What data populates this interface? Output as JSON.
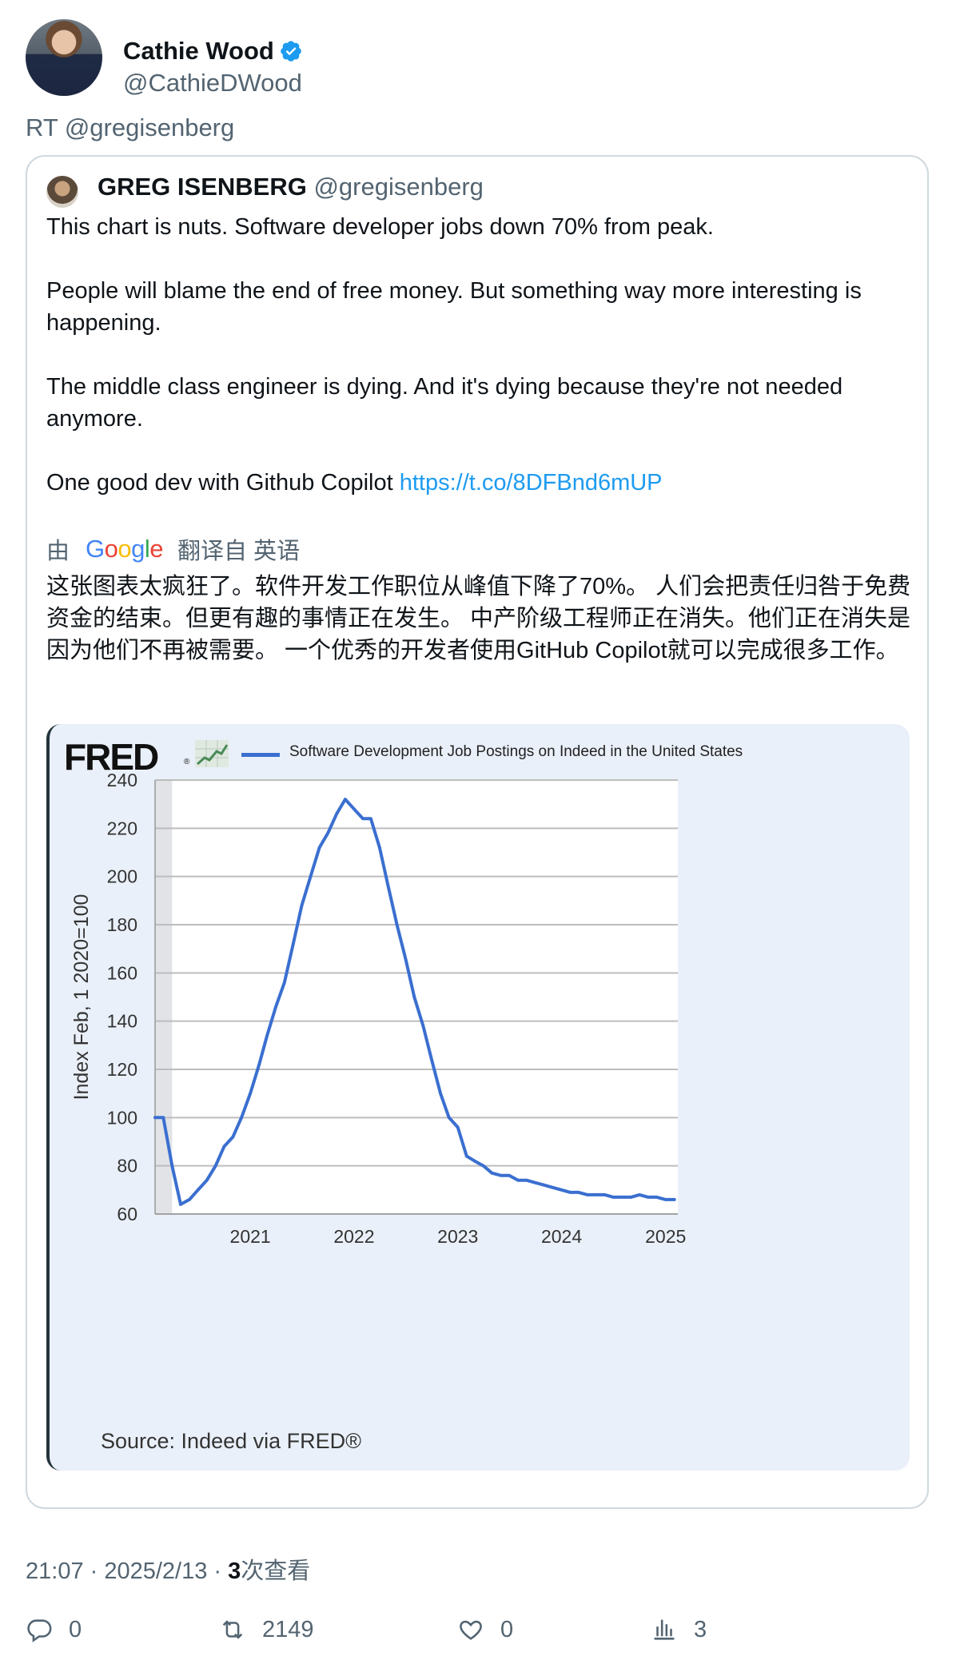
{
  "author": {
    "display_name": "Cathie Wood",
    "handle": "@CathieDWood",
    "verified": true,
    "avatar_icon": "profile-photo"
  },
  "retweet_line": "RT @gregisenberg",
  "quoted": {
    "display_name": "GREG ISENBERG",
    "handle": "@gregisenberg",
    "paragraphs": [
      "This chart is nuts. Software developer jobs down 70% from peak.",
      "People will blame the end of free money. But something way more interesting is happening.",
      "The middle class engineer is dying. And it's dying because they're not needed anymore."
    ],
    "last_line_text": "One good dev with Github Copilot ",
    "link": "https://t.co/8DFBnd6mUP",
    "translate": {
      "prefix": "由",
      "google": "Google",
      "suffix": "翻译自 英语"
    },
    "translated_text": "这张图表太疯狂了。软件开发工作职位从峰值下降了70%。 人们会把责任归咎于免费资金的结束。但更有趣的事情正在发生。 中产阶级工程师正在消失。他们正在消失是因为他们不再被需要。 一个优秀的开发者使用GitHub Copilot就可以完成很多工作。"
  },
  "chart_data": {
    "type": "line",
    "brand": "FRED",
    "series": [
      {
        "name": "Software Development Job Postings on Indeed in the United States",
        "color": "#3a6fd0",
        "x": [
          "2020-02-01",
          "2020-03-01",
          "2020-04-01",
          "2020-05-01",
          "2020-06-01",
          "2020-07-01",
          "2020-08-01",
          "2020-09-01",
          "2020-10-01",
          "2020-11-01",
          "2020-12-01",
          "2021-01-01",
          "2021-02-01",
          "2021-03-01",
          "2021-04-01",
          "2021-05-01",
          "2021-06-01",
          "2021-07-01",
          "2021-08-01",
          "2021-09-01",
          "2021-10-01",
          "2021-11-01",
          "2021-12-01",
          "2022-01-01",
          "2022-02-01",
          "2022-03-01",
          "2022-04-01",
          "2022-05-01",
          "2022-06-01",
          "2022-07-01",
          "2022-08-01",
          "2022-09-01",
          "2022-10-01",
          "2022-11-01",
          "2022-12-01",
          "2023-01-01",
          "2023-02-01",
          "2023-03-01",
          "2023-04-01",
          "2023-05-01",
          "2023-06-01",
          "2023-07-01",
          "2023-08-01",
          "2023-09-01",
          "2023-10-01",
          "2023-11-01",
          "2023-12-01",
          "2024-01-01",
          "2024-02-01",
          "2024-03-01",
          "2024-04-01",
          "2024-05-01",
          "2024-06-01",
          "2024-07-01",
          "2024-08-01",
          "2024-09-01",
          "2024-10-01",
          "2024-11-01",
          "2024-12-01",
          "2025-01-01",
          "2025-02-01"
        ],
        "values": [
          100,
          100,
          80,
          64,
          66,
          70,
          74,
          80,
          88,
          92,
          100,
          110,
          122,
          134,
          146,
          156,
          172,
          188,
          200,
          212,
          218,
          226,
          232,
          228,
          224,
          224,
          212,
          196,
          180,
          166,
          150,
          138,
          124,
          110,
          100,
          96,
          84,
          82,
          80,
          77,
          76,
          76,
          74,
          74,
          73,
          72,
          71,
          70,
          69,
          69,
          68,
          68,
          68,
          67,
          67,
          67,
          68,
          67,
          67,
          66,
          66
        ]
      }
    ],
    "title": "Software Development Job Postings on Indeed in the United States",
    "xlabel": "",
    "ylabel": "Index Feb, 1 2020=100",
    "ylim": [
      60,
      240
    ],
    "y_ticks": [
      240,
      220,
      200,
      180,
      160,
      140,
      120,
      100,
      80,
      60
    ],
    "x_ticks": [
      "2021",
      "2022",
      "2023",
      "2024",
      "2025"
    ],
    "grid": true,
    "recession_shading": [
      "2020-02-01",
      "2020-04-01"
    ],
    "source": "Source: Indeed via FRED®"
  },
  "timestamp": {
    "time_date": "21:07 · 2025/2/13 · ",
    "views_count": "3",
    "views_label": "次查看"
  },
  "actions": {
    "reply_count": "0",
    "retweet_count": "2149",
    "like_count": "0",
    "views_count": "3"
  }
}
